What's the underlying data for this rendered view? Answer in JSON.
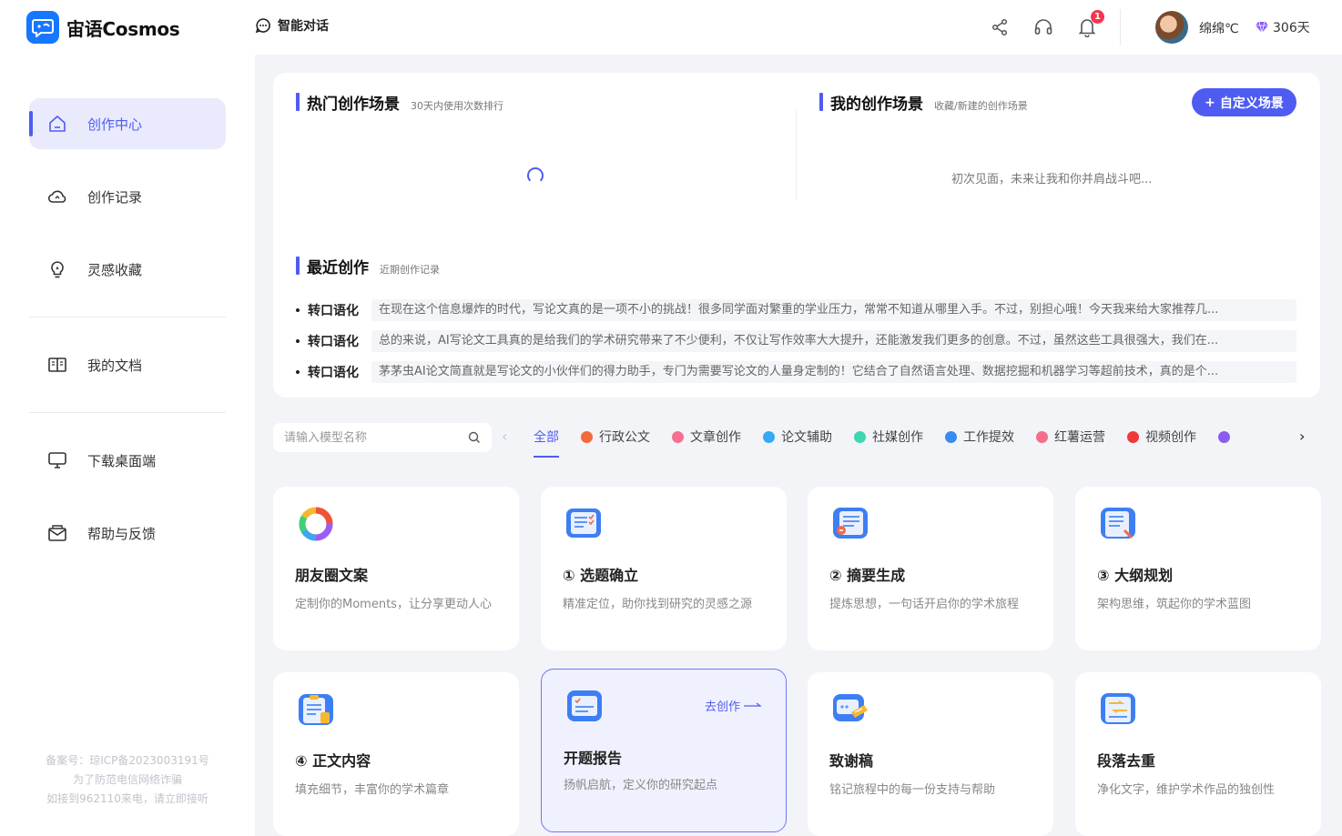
{
  "header": {
    "app_name": "宙语Cosmos",
    "nav_chat": "智能对话",
    "notification_count": "1",
    "username": "绵绵℃",
    "vip_days": "306天"
  },
  "sidebar": {
    "items": [
      {
        "label": "创作中心",
        "icon": "home-icon"
      },
      {
        "label": "创作记录",
        "icon": "cloud-icon"
      },
      {
        "label": "灵感收藏",
        "icon": "lightbulb-icon"
      },
      {
        "label": "我的文档",
        "icon": "book-icon"
      },
      {
        "label": "下载桌面端",
        "icon": "monitor-icon"
      },
      {
        "label": "帮助与反馈",
        "icon": "mail-icon"
      }
    ],
    "footer": [
      "备案号：琼ICP备2023003191号",
      "为了防范电信网络诈骗",
      "如接到962110来电，请立即接听"
    ]
  },
  "hot": {
    "title": "热门创作场景",
    "subtitle": "30天内使用次数排行"
  },
  "mine": {
    "title": "我的创作场景",
    "subtitle": "收藏/新建的创作场景",
    "custom_button": "自定义场景",
    "empty": "初次见面，未来让我和你并肩战斗吧..."
  },
  "recent": {
    "title": "最近创作",
    "subtitle": "近期创作记录",
    "rows": [
      {
        "tag": "转口语化",
        "text": "在现在这个信息爆炸的时代，写论文真的是一项不小的挑战！很多同学面对繁重的学业压力，常常不知道从哪里入手。不过，别担心哦！今天我来给大家推荐几..."
      },
      {
        "tag": "转口语化",
        "text": "总的来说，AI写论文工具真的是给我们的学术研究带来了不少便利，不仅让写作效率大大提升，还能激发我们更多的创意。不过，虽然这些工具很强大，我们在..."
      },
      {
        "tag": "转口语化",
        "text": "茅茅虫AI论文简直就是写论文的小伙伴们的得力助手，专门为需要写论文的人量身定制的！它结合了自然语言处理、数据挖掘和机器学习等超前技术，真的是个..."
      }
    ]
  },
  "filter": {
    "search_placeholder": "请输入模型名称",
    "categories": [
      {
        "label": "全部",
        "color": ""
      },
      {
        "label": "行政公文",
        "color": "#f26b3a"
      },
      {
        "label": "文章创作",
        "color": "#f5718f"
      },
      {
        "label": "论文辅助",
        "color": "#35a9f3"
      },
      {
        "label": "社媒创作",
        "color": "#3fd6b0"
      },
      {
        "label": "工作提效",
        "color": "#3a8bf0"
      },
      {
        "label": "红薯运营",
        "color": "#f56f8b"
      },
      {
        "label": "视频创作",
        "color": "#f03a3a"
      },
      {
        "label": "",
        "color": "#8c5cf0"
      }
    ]
  },
  "cards": [
    {
      "title": "朋友圈文案",
      "desc": "定制你的Moments，让分享更动人心",
      "icon": "ring-icon"
    },
    {
      "title": "① 选题确立",
      "desc": "精准定位，助你找到研究的灵感之源",
      "icon": "checklist-icon"
    },
    {
      "title": "② 摘要生成",
      "desc": "提炼思想，一句话开启你的学术旅程",
      "icon": "doc-pen-icon"
    },
    {
      "title": "③ 大纲规划",
      "desc": "架构思维，筑起你的学术蓝图",
      "icon": "outline-icon"
    },
    {
      "title": "④ 正文内容",
      "desc": "填充细节，丰富你的学术篇章",
      "icon": "clipboard-icon"
    },
    {
      "title": "开题报告",
      "desc": "扬帆启航，定义你的研究起点",
      "icon": "report-icon",
      "action": "去创作"
    },
    {
      "title": "致谢稿",
      "desc": "铭记旅程中的每一份支持与帮助",
      "icon": "thanks-icon"
    },
    {
      "title": "段落去重",
      "desc": "净化文字，维护学术作品的独创性",
      "icon": "dedupe-icon"
    }
  ]
}
